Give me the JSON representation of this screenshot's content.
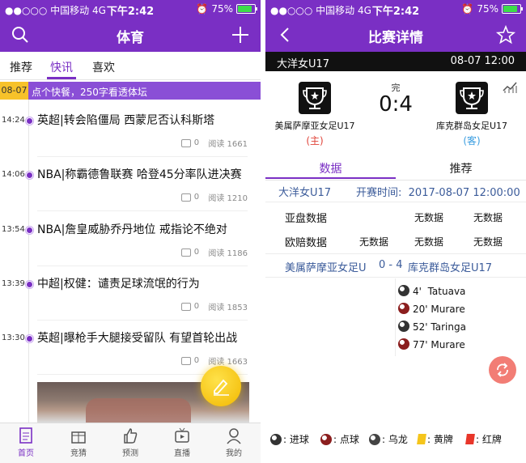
{
  "status_bar": {
    "carrier": "●●○○○ 中国移动",
    "network": "4G",
    "time": "下午2:42",
    "battery": "75%",
    "battery_level": 0.75
  },
  "left": {
    "nav": {
      "title": "体育",
      "search_icon": "search-icon",
      "add_icon": "plus-icon"
    },
    "tabs": [
      "推荐",
      "快讯",
      "喜欢"
    ],
    "active_tab": "快讯",
    "notice": {
      "date": "08-07",
      "text": "点个快餐，250字看透体坛"
    },
    "feed": [
      {
        "time": "14:24",
        "title": "英超|转会陷僵局 西蒙尼否认科斯塔",
        "comments": "0",
        "reads": "阅读 1661"
      },
      {
        "time": "14:06",
        "title": "NBA|称霸德鲁联赛 哈登45分率队进决赛",
        "comments": "0",
        "reads": "阅读 1210"
      },
      {
        "time": "13:54",
        "title": "NBA|詹皇威胁乔丹地位 戒指论不绝对",
        "comments": "0",
        "reads": "阅读 1186"
      },
      {
        "time": "13:39",
        "title": "中超|权健：谴责足球流氓的行为",
        "comments": "0",
        "reads": "阅读 1853"
      },
      {
        "time": "13:30",
        "title": "英超|曝枪手大腿接受留队 有望首轮出战",
        "comments": "0",
        "reads": "阅读 1663"
      }
    ],
    "tabbar": [
      "首页",
      "竞猜",
      "预测",
      "直播",
      "我的"
    ],
    "active_tabbar": "首页"
  },
  "right": {
    "nav": {
      "title": "比赛详情",
      "back_icon": "chevron-left-icon",
      "star_icon": "star-icon"
    },
    "match": {
      "league": "大洋女U17",
      "datetime": "08-07 12:00",
      "status": "完",
      "score": "0:4",
      "home": {
        "name": "美属萨摩亚女足U17",
        "role": "(主)"
      },
      "away": {
        "name": "库克群岛女足U17",
        "role": "(客)"
      }
    },
    "tabs": [
      "数据",
      "推荐"
    ],
    "active_tab": "数据",
    "info": {
      "league": "大洋女U17",
      "start": "开赛时间:",
      "start_time": "2017-08-07 12:00:00"
    },
    "odds": [
      {
        "label": "亚盘数据",
        "cols": [
          "",
          "无数据",
          "无数据"
        ]
      },
      {
        "label": "欧赔数据",
        "cols": [
          "无数据",
          "无数据",
          "无数据"
        ]
      }
    ],
    "score_row": {
      "home": "美属萨摩亚女足U17",
      "score": "0 - 4",
      "away": "库克群岛女足U17"
    },
    "events": [
      {
        "minute": "4'",
        "player": "Tatuava",
        "type": "goal"
      },
      {
        "minute": "20'",
        "player": "Murare",
        "type": "penalty"
      },
      {
        "minute": "52'",
        "player": "Taringa",
        "type": "goal"
      },
      {
        "minute": "77'",
        "player": "Murare",
        "type": "penalty"
      }
    ],
    "legend": [
      ": 进球",
      ": 点球",
      ": 乌龙",
      ": 黄牌",
      ": 红牌"
    ],
    "colors": {
      "brand": "#7a2fc4",
      "home_role": "#e0443a",
      "away_role": "#3a9de0",
      "refresh": "#f27d75"
    }
  }
}
